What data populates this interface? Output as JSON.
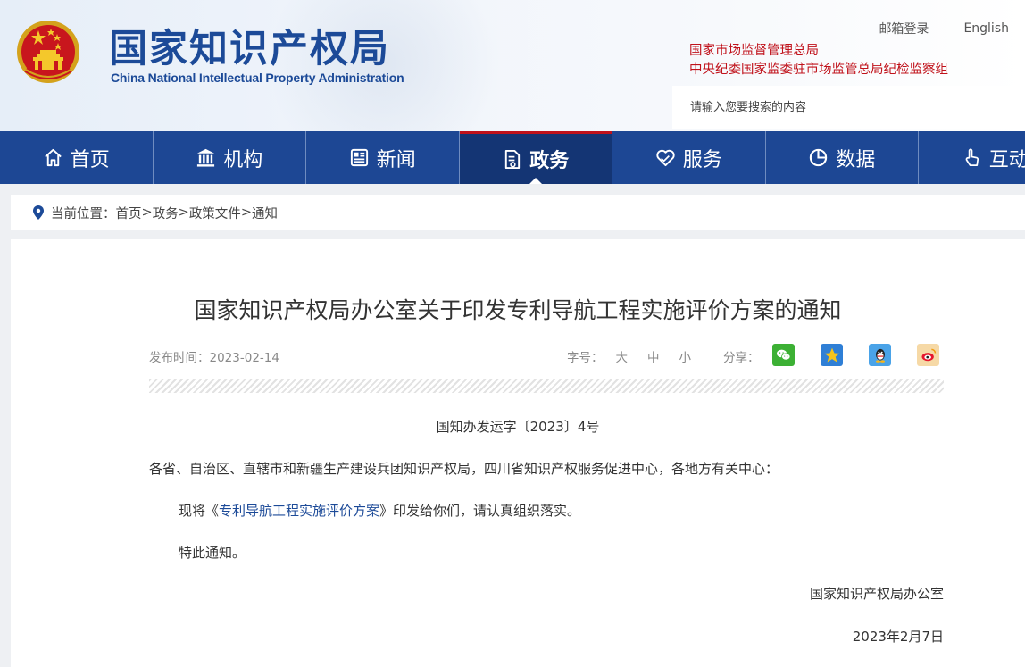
{
  "header": {
    "site_name_cn": "国家知识产权局",
    "site_name_en": "China National Intellectual Property Administration",
    "top_links": {
      "mail_login": "邮箱登录",
      "english": "English"
    },
    "admin_lines": [
      "国家市场监督管理总局",
      "中央纪委国家监委驻市场监管总局纪检监察组"
    ],
    "search_placeholder": "请输入您要搜索的内容"
  },
  "nav": {
    "items": [
      {
        "label": "首页",
        "icon": "home-icon"
      },
      {
        "label": "机构",
        "icon": "institution-icon"
      },
      {
        "label": "新闻",
        "icon": "news-icon"
      },
      {
        "label": "政务",
        "icon": "document-icon",
        "active": true
      },
      {
        "label": "服务",
        "icon": "service-icon"
      },
      {
        "label": "数据",
        "icon": "pie-chart-icon"
      },
      {
        "label": "互动",
        "icon": "interaction-icon"
      }
    ]
  },
  "breadcrumb": {
    "prefix": "当前位置：",
    "crumbs": [
      "首页",
      "政务",
      "政策文件",
      "通知"
    ],
    "separator": ">"
  },
  "article": {
    "title": "国家知识产权局办公室关于印发专利导航工程实施评价方案的通知",
    "publish_label": "发布时间：",
    "publish_date": "2023-02-14",
    "font_size_label": "字号：",
    "font_sizes": [
      "大",
      "中",
      "小"
    ],
    "share_label": "分享：",
    "share_icons": [
      "wechat-icon",
      "qzone-icon",
      "qq-icon",
      "weibo-icon"
    ],
    "doc_number": "国知办发运字〔2023〕4号",
    "salutation": "各省、自治区、直辖市和新疆生产建设兵团知识产权局，四川省知识产权服务促进中心，各地方有关中心：",
    "para1_prefix": "现将《",
    "para1_link": "专利导航工程实施评价方案",
    "para1_suffix": "》印发给你们，请认真组织落实。",
    "para2": "特此通知。",
    "signature": "国家知识产权局办公室",
    "sign_date": "2023年2月7日"
  },
  "colors": {
    "nav_bg": "#1d4794",
    "nav_active_bg": "#143574",
    "brand_blue": "#1c4a98",
    "alert_red": "#c0121b"
  }
}
